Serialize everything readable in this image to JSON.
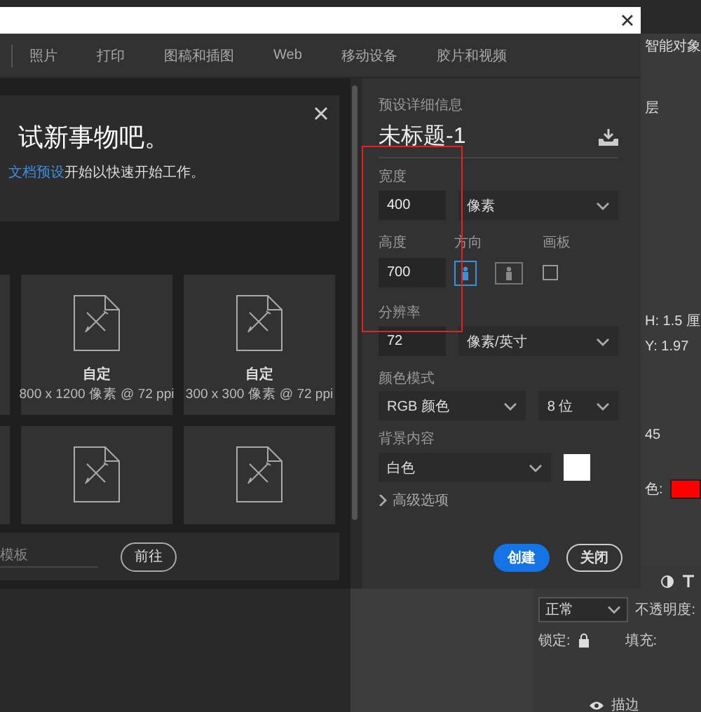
{
  "tabs": [
    {
      "label": "照片",
      "selected": false
    },
    {
      "label": "打印",
      "selected": false
    },
    {
      "label": "图稿和插图",
      "selected": false
    },
    {
      "label": "Web",
      "selected": false
    },
    {
      "label": "移动设备",
      "selected": false
    },
    {
      "label": "胶片和视频",
      "selected": false
    }
  ],
  "intro": {
    "title": "试新事物吧。",
    "link": "文档预设",
    "text_after": "开始以快速开始工作。"
  },
  "tiles": [
    {
      "kind": "preset",
      "name": "自定",
      "size": "800 x 1200 像素 @ 72 ppi"
    },
    {
      "kind": "preset",
      "name": "自定",
      "size": "300 x 300 像素 @ 72 ppi"
    },
    {
      "kind": "blank"
    },
    {
      "kind": "blank"
    }
  ],
  "template_search": {
    "placeholder": "模板",
    "button": "前往"
  },
  "details": {
    "heading": "预设详细信息",
    "doc_name": "未标题-1",
    "width": {
      "label": "宽度",
      "value": "400",
      "unit": "像素"
    },
    "height": {
      "label": "高度",
      "value": "700"
    },
    "orientation": {
      "label": "方向",
      "options": [
        {
          "kind": "portrait",
          "selected": true
        },
        {
          "kind": "landscape",
          "selected": false
        }
      ]
    },
    "artboard": {
      "label": "画板",
      "checked": false
    },
    "resolution": {
      "label": "分辨率",
      "value": "72",
      "unit": "像素/英寸"
    },
    "color_mode": {
      "label": "颜色模式",
      "mode": "RGB 颜色",
      "depth": "8 位"
    },
    "background": {
      "label": "背景内容",
      "value": "白色",
      "color": "#ffffff"
    },
    "advanced": {
      "label": "高级选项",
      "expanded": false
    },
    "buttons": [
      {
        "label": "创建",
        "kind": "primary"
      },
      {
        "label": "关闭",
        "kind": "secondary"
      }
    ]
  },
  "side_panel": {
    "items": [
      "智能对象",
      "层",
      "H: 1.5 厘",
      "Y: 1.97",
      "45"
    ],
    "color_label": "色:",
    "color": "#ff0000"
  },
  "layers_panel": {
    "blend_mode": "正常",
    "opacity_label": "不透明度:",
    "lock_label": "锁定:",
    "fill_label": "填充:",
    "effect": "描边"
  }
}
